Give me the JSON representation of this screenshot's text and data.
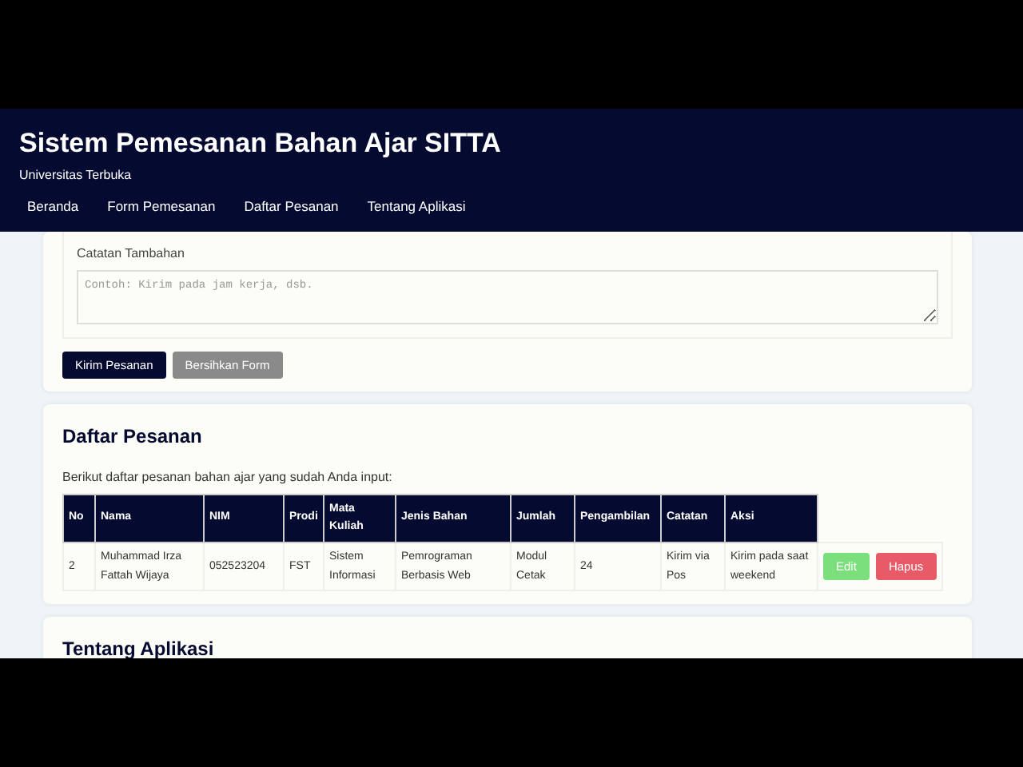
{
  "header": {
    "title": "Sistem Pemesanan Bahan Ajar SITTA",
    "subtitle": "Universitas Terbuka",
    "nav": [
      {
        "label": "Beranda"
      },
      {
        "label": "Form Pemesanan"
      },
      {
        "label": "Daftar Pesanan"
      },
      {
        "label": "Tentang Aplikasi"
      }
    ]
  },
  "form": {
    "notes": {
      "label": "Catatan Tambahan",
      "placeholder": "Contoh: Kirim pada jam kerja, dsb."
    },
    "buttons": [
      {
        "label": "Kirim Pesanan",
        "kind": "primary"
      },
      {
        "label": "Bersihkan Form",
        "kind": "secondary"
      }
    ]
  },
  "orders": {
    "title": "Daftar Pesanan",
    "intro": "Berikut daftar pesanan bahan ajar yang sudah Anda input:",
    "table": {
      "columns": [
        "No",
        "Nama",
        "NIM",
        "Prodi",
        "Mata Kuliah",
        "Jenis Bahan",
        "Jumlah",
        "Pengambilan",
        "Catatan",
        "Aksi"
      ],
      "rows": [
        {
          "cells": [
            "2",
            "Muhammad Irza Fattah Wijaya",
            "052523204",
            "FST",
            "Sistem Informasi",
            "Pemrograman Berbasis Web",
            "Modul Cetak",
            "24",
            "Kirim via Pos",
            "Kirim pada saat weekend"
          ],
          "actions": [
            {
              "label": "Edit",
              "kind": "edit"
            },
            {
              "label": "Hapus",
              "kind": "delete"
            }
          ]
        }
      ]
    }
  },
  "about": {
    "title": "Tentang Aplikasi"
  }
}
